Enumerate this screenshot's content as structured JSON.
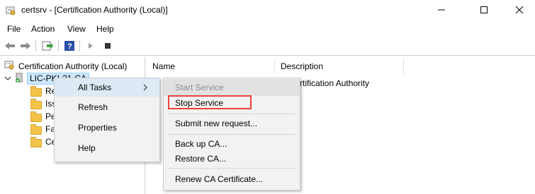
{
  "window": {
    "title": "certsrv - [Certification Authority (Local)]",
    "minimize_icon": "minimize-icon",
    "maximize_icon": "maximize-icon",
    "close_icon": "close-icon"
  },
  "menubar": {
    "items": [
      "File",
      "Action",
      "View",
      "Help"
    ]
  },
  "toolbar": {
    "icons": [
      "back-arrow-icon",
      "forward-arrow-icon",
      "export-list-icon",
      "help-icon",
      "play-icon",
      "stop-icon"
    ]
  },
  "tree": {
    "root_label": "Certification Authority (Local)",
    "ca_label": "LIC-PKI-21-CA",
    "folders": [
      "Re",
      "Iss",
      "Pe",
      "Fa",
      "Ce"
    ]
  },
  "list": {
    "columns": [
      "Name",
      "Description"
    ],
    "row_description": "rtification Authority"
  },
  "context_menu": {
    "items": [
      "All Tasks",
      "Refresh",
      "Properties",
      "Help"
    ],
    "submenu_arrow": "chevron-right-icon"
  },
  "submenu": {
    "items": [
      "Start Service",
      "Stop Service",
      "Submit new request...",
      "Back up CA...",
      "Restore CA...",
      "Renew CA Certificate..."
    ],
    "highlight_color": "#e8443a"
  }
}
